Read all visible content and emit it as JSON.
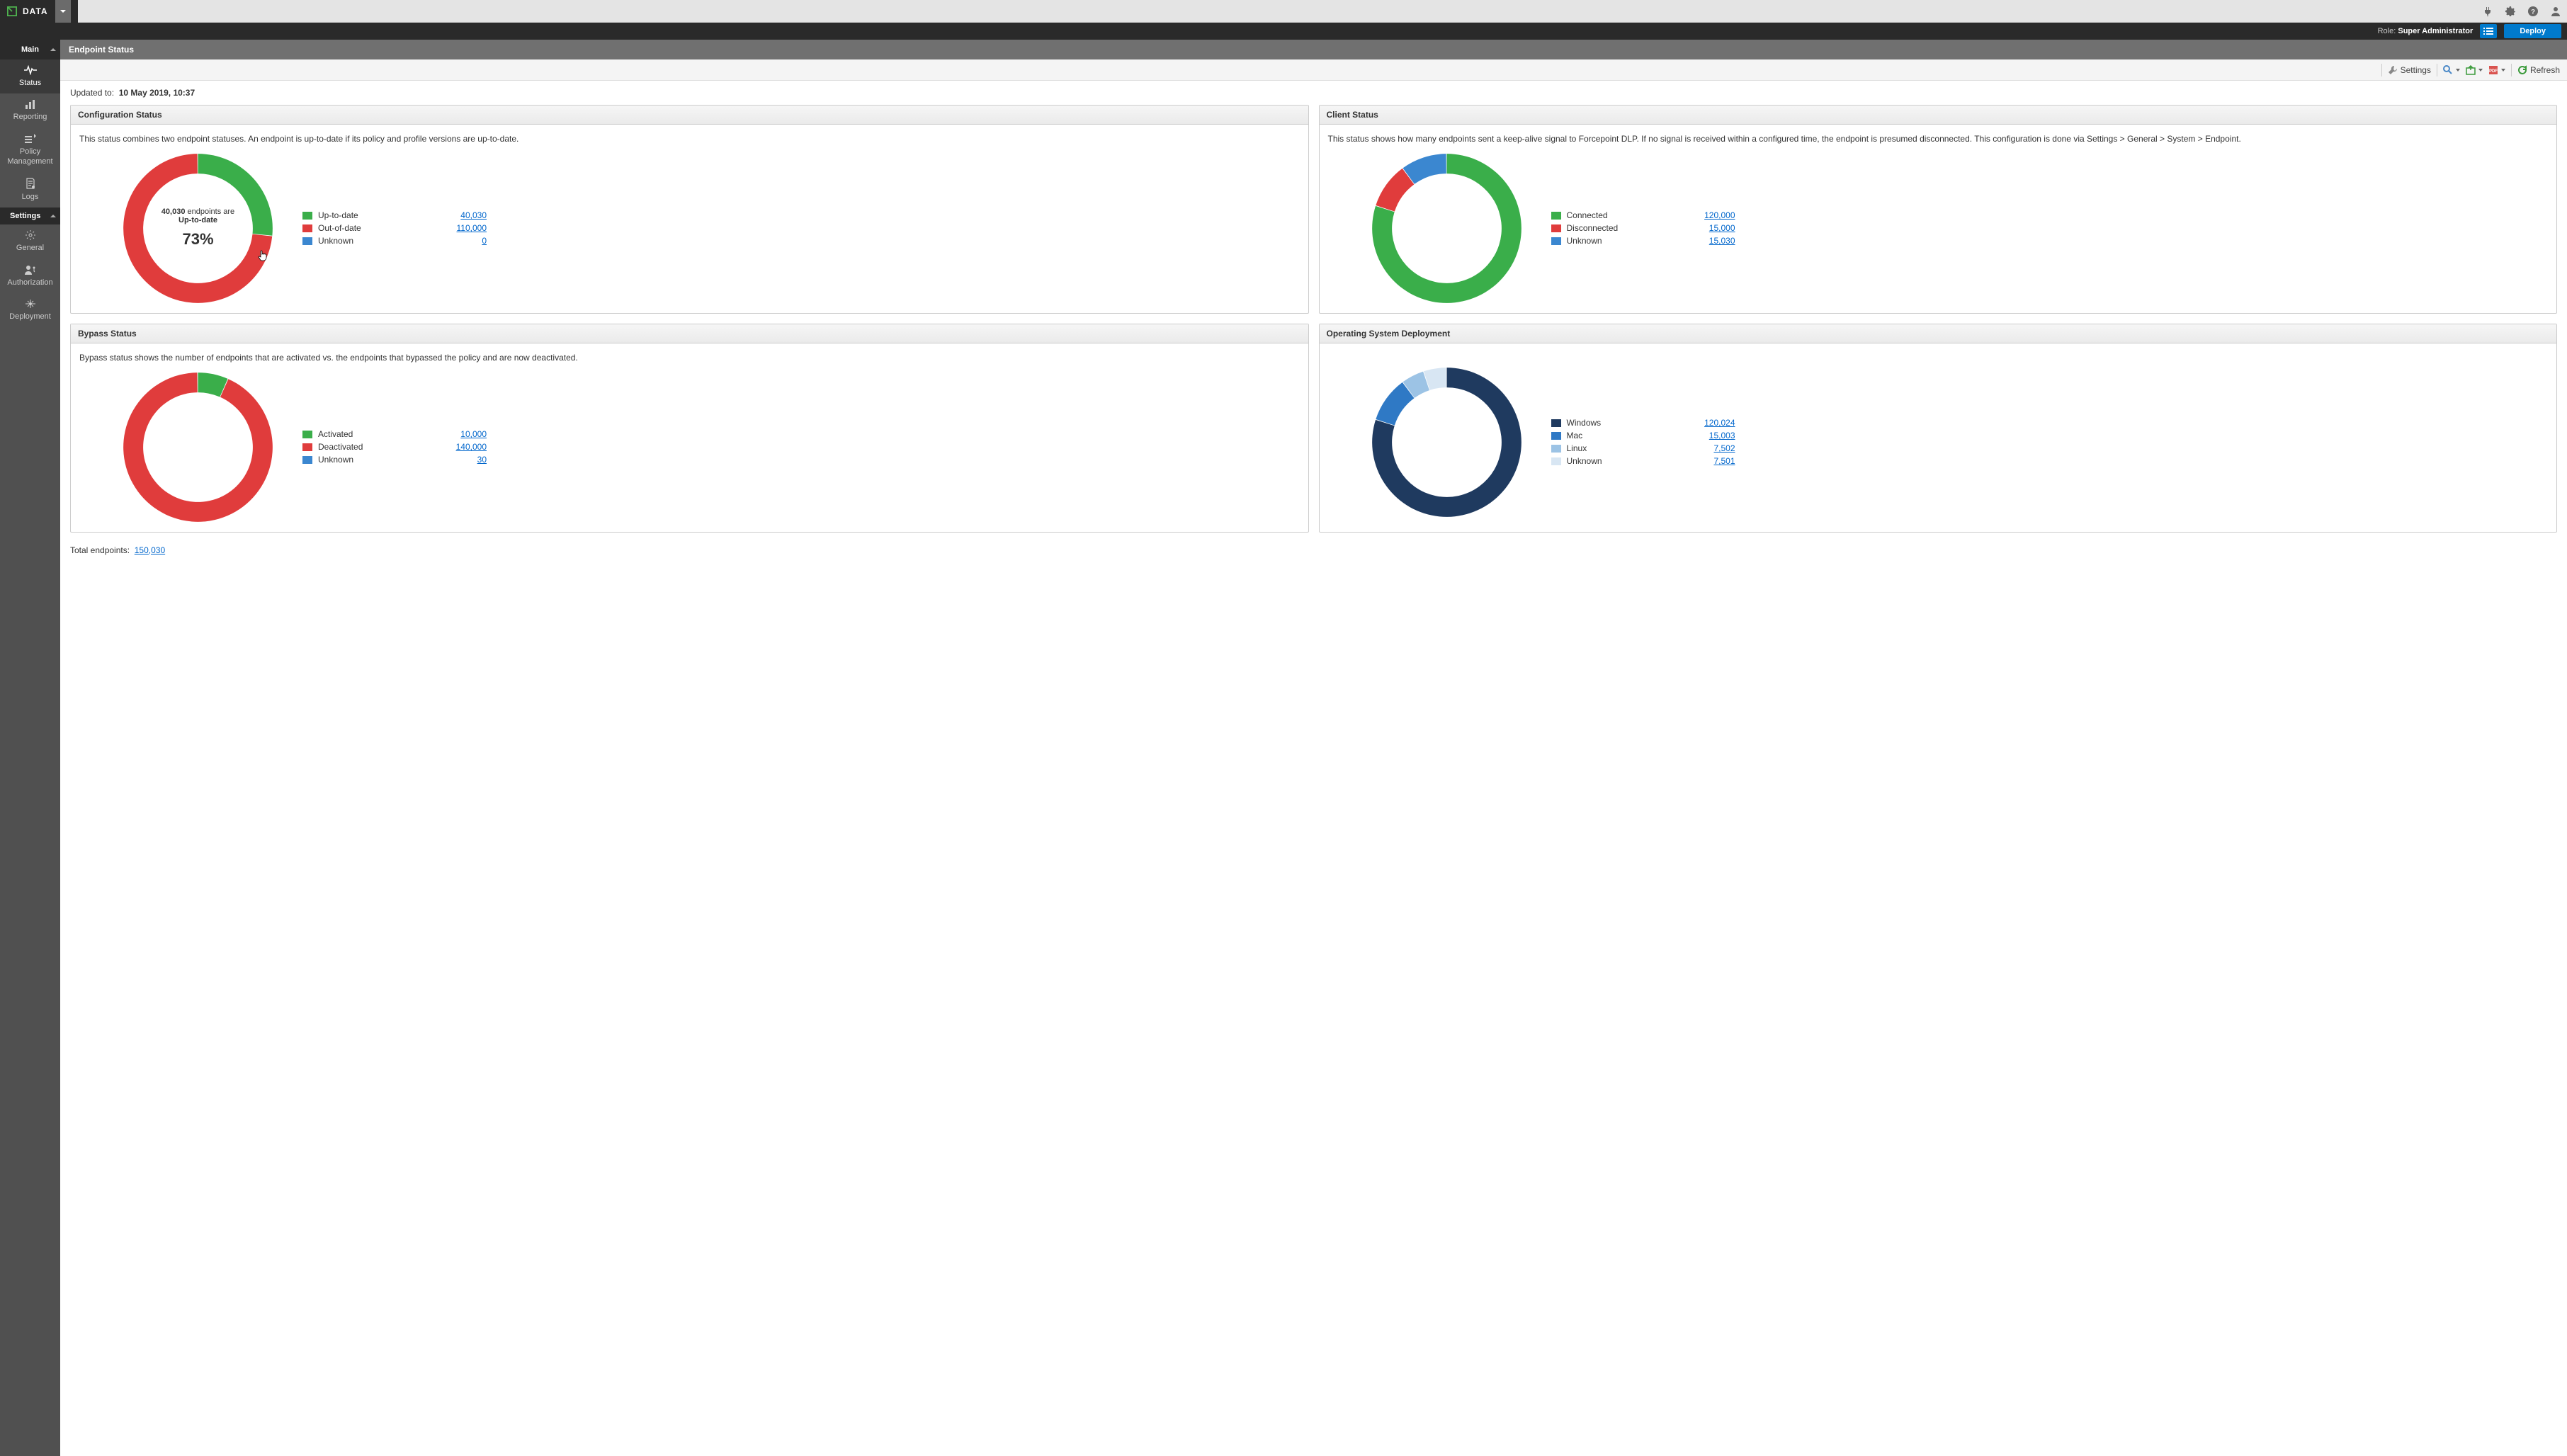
{
  "app": {
    "name": "DATA"
  },
  "rolebar": {
    "role_label": "Role:",
    "role": "Super Administrator",
    "deploy": "Deploy"
  },
  "sidebar": {
    "main": "Main",
    "items": [
      {
        "label": "Status"
      },
      {
        "label": "Reporting"
      },
      {
        "label": "Policy\nManagement"
      },
      {
        "label": "Logs"
      }
    ],
    "settings_header": "Settings",
    "settings_items": [
      {
        "label": "General"
      },
      {
        "label": "Authorization"
      },
      {
        "label": "Deployment"
      }
    ]
  },
  "page": {
    "title": "Endpoint Status",
    "updated_label": "Updated to:",
    "updated_value": "10 May 2019, 10:37",
    "footer_label": "Total endpoints:",
    "footer_value": "150,030",
    "toolbar": {
      "settings": "Settings",
      "refresh": "Refresh"
    }
  },
  "colors": {
    "green": "#3aae4a",
    "red": "#e03c3c",
    "blue": "#3b87d0",
    "navy": "#1f3a5f",
    "blue2": "#2f79c5",
    "ltblue": "#9cc3e5",
    "paleblue": "#d8e6f3"
  },
  "panels": {
    "config": {
      "title": "Configuration Status",
      "desc": "This status combines two endpoint statuses. An endpoint is up-to-date if its policy and profile versions are up-to-date.",
      "center_count": "40,030",
      "center_text": "endpoints are",
      "center_status": "Up-to-date",
      "center_pct": "73%",
      "legend": [
        {
          "label": "Up-to-date",
          "value": "40,030",
          "color": "green"
        },
        {
          "label": "Out-of-date",
          "value": "110,000",
          "color": "red"
        },
        {
          "label": "Unknown",
          "value": "0",
          "color": "blue"
        }
      ]
    },
    "client": {
      "title": "Client Status",
      "desc": "This status shows how many endpoints sent a keep-alive signal to Forcepoint DLP. If no signal is received within a configured time, the endpoint is presumed disconnected. This configuration is done via Settings > General > System > Endpoint.",
      "legend": [
        {
          "label": "Connected",
          "value": "120,000",
          "color": "green"
        },
        {
          "label": "Disconnected",
          "value": "15,000",
          "color": "red"
        },
        {
          "label": "Unknown",
          "value": "15,030",
          "color": "blue"
        }
      ]
    },
    "bypass": {
      "title": "Bypass Status",
      "desc": "Bypass status shows the number of endpoints that are activated vs. the endpoints that bypassed the policy and are now deactivated.",
      "legend": [
        {
          "label": "Activated",
          "value": "10,000",
          "color": "green"
        },
        {
          "label": "Deactivated",
          "value": "140,000",
          "color": "red"
        },
        {
          "label": "Unknown",
          "value": "30",
          "color": "blue"
        }
      ]
    },
    "os": {
      "title": "Operating System Deployment",
      "legend": [
        {
          "label": "Windows",
          "value": "120,024",
          "color": "navy"
        },
        {
          "label": "Mac",
          "value": "15,003",
          "color": "blue2"
        },
        {
          "label": "Linux",
          "value": "7,502",
          "color": "ltblue"
        },
        {
          "label": "Unknown",
          "value": "7,501",
          "color": "paleblue"
        }
      ]
    }
  },
  "chart_data": [
    {
      "type": "pie",
      "title": "Configuration Status",
      "series": [
        {
          "name": "Up-to-date",
          "value": 40030
        },
        {
          "name": "Out-of-date",
          "value": 110000
        },
        {
          "name": "Unknown",
          "value": 0
        }
      ]
    },
    {
      "type": "pie",
      "title": "Client Status",
      "series": [
        {
          "name": "Connected",
          "value": 120000
        },
        {
          "name": "Disconnected",
          "value": 15000
        },
        {
          "name": "Unknown",
          "value": 15030
        }
      ]
    },
    {
      "type": "pie",
      "title": "Bypass Status",
      "series": [
        {
          "name": "Activated",
          "value": 10000
        },
        {
          "name": "Deactivated",
          "value": 140000
        },
        {
          "name": "Unknown",
          "value": 30
        }
      ]
    },
    {
      "type": "pie",
      "title": "Operating System Deployment",
      "series": [
        {
          "name": "Windows",
          "value": 120024
        },
        {
          "name": "Mac",
          "value": 15003
        },
        {
          "name": "Linux",
          "value": 7502
        },
        {
          "name": "Unknown",
          "value": 7501
        }
      ]
    }
  ]
}
